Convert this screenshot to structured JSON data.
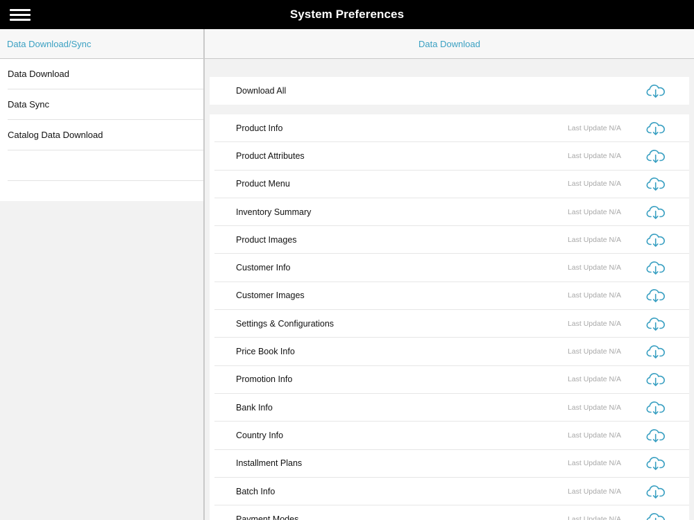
{
  "app": {
    "title": "System Preferences"
  },
  "icons": {
    "menu": "hamburger-menu-icon",
    "download": "cloud-download-icon"
  },
  "colors": {
    "accent": "#3aa0c2",
    "topbar": "#000000"
  },
  "sidebar": {
    "header": "Data Download/Sync",
    "items": [
      {
        "label": "Data Download"
      },
      {
        "label": "Data Sync"
      },
      {
        "label": "Catalog Data Download"
      },
      {
        "label": ""
      }
    ]
  },
  "main": {
    "header": "Data Download",
    "download_all": {
      "label": "Download All"
    },
    "rows": [
      {
        "label": "Product Info",
        "updated": "Last Update N/A"
      },
      {
        "label": "Product Attributes",
        "updated": "Last Update N/A"
      },
      {
        "label": "Product Menu",
        "updated": "Last Update N/A"
      },
      {
        "label": "Inventory Summary",
        "updated": "Last Update N/A"
      },
      {
        "label": "Product Images",
        "updated": "Last Update N/A"
      },
      {
        "label": "Customer Info",
        "updated": "Last Update N/A"
      },
      {
        "label": "Customer Images",
        "updated": "Last Update N/A"
      },
      {
        "label": "Settings & Configurations",
        "updated": "Last Update N/A"
      },
      {
        "label": "Price Book Info",
        "updated": "Last Update N/A"
      },
      {
        "label": "Promotion Info",
        "updated": "Last Update N/A"
      },
      {
        "label": "Bank Info",
        "updated": "Last Update N/A"
      },
      {
        "label": "Country Info",
        "updated": "Last Update N/A"
      },
      {
        "label": "Installment Plans",
        "updated": "Last Update N/A"
      },
      {
        "label": "Batch Info",
        "updated": "Last Update N/A"
      },
      {
        "label": "Payment Modes",
        "updated": "Last Update N/A"
      }
    ]
  }
}
